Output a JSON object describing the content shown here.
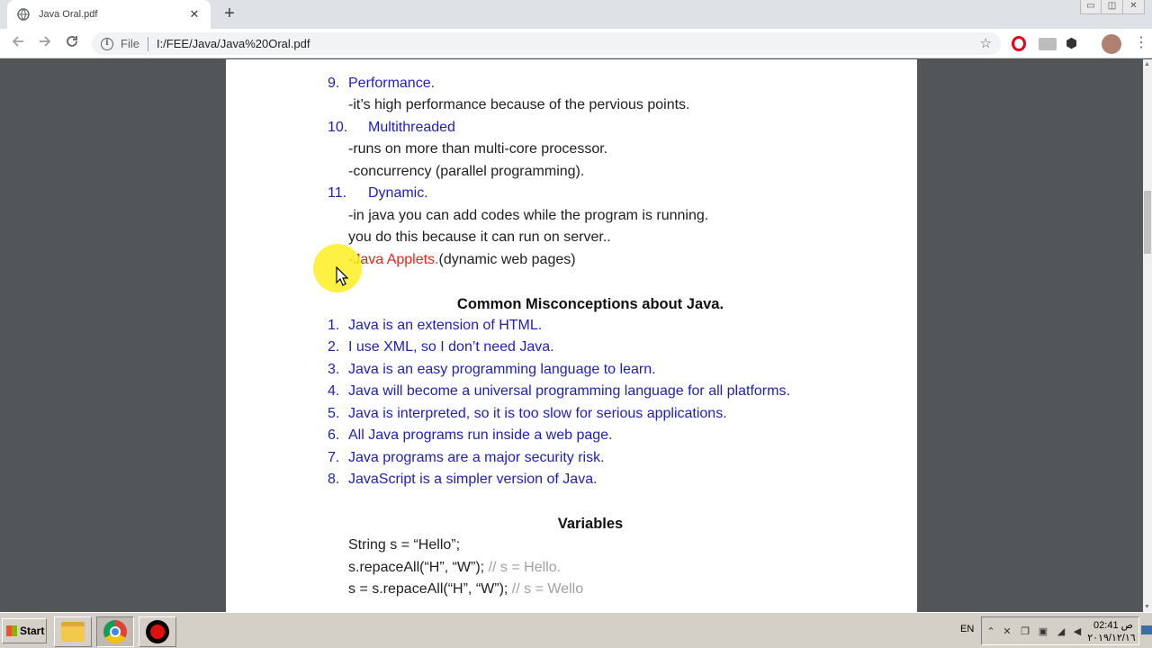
{
  "browser": {
    "tab_title": "Java Oral.pdf",
    "tab_close": "✕",
    "new_tab": "+",
    "omnibox_scheme": "File",
    "url": "I:/FEE/Java/Java%20Oral.pdf",
    "window_controls": [
      "▭",
      "◫",
      "✕"
    ]
  },
  "doc": {
    "item9_num": "9.",
    "item9_title": "Performance.",
    "item9_desc": "-it’s high performance because of the pervious points.",
    "item10_num": "10.",
    "item10_title": "Multithreaded",
    "item10_desc1": "-runs on more than multi-core processor.",
    "item10_desc2": "-concurrency (parallel programming).",
    "item11_num": "11.",
    "item11_title": "Dynamic.",
    "item11_desc1": "-in java you can add codes while the program is running.",
    "item11_desc2": "you do this because it can run on server..",
    "applets_dash": "-",
    "applets_label": "Java Applets.",
    "applets_rest": "(dynamic web pages)",
    "misconceptions_heading": "Common Misconceptions about Java.",
    "misconceptions": [
      {
        "num": "1.",
        "text": "Java is an extension of HTML."
      },
      {
        "num": "2.",
        "text": "I use XML, so I don’t need Java."
      },
      {
        "num": "3.",
        "text": "Java is an easy programming language to learn."
      },
      {
        "num": "4.",
        "text": "Java will become a universal programming language for all platforms."
      },
      {
        "num": "5.",
        "text": "Java is interpreted, so it is too slow for serious applications."
      },
      {
        "num": "6.",
        "text": "All Java programs run inside a web page."
      },
      {
        "num": "7.",
        "text": "Java programs are a major security risk."
      },
      {
        "num": "8.",
        "text": "JavaScript is a simpler version of Java."
      }
    ],
    "variables_heading": "Variables",
    "code1": "String s = “Hello”;",
    "code2": "s.repaceAll(“H”, “W”);",
    "code2_comment": "// s = Hello.",
    "code3": "s = s.repaceAll(“H”, “W”);",
    "code3_comment": "// s = Wello"
  },
  "taskbar": {
    "start_label": "Start",
    "lang": "EN",
    "clock_time": "02:41 ص",
    "clock_date": "٢٠١٩/١٢/١٦"
  },
  "icons": {
    "back": "arrow-left-icon",
    "forward": "arrow-right-icon",
    "reload": "reload-icon",
    "star": "star-icon"
  },
  "colors": {
    "link_blue": "#1f1fb5",
    "applets_red": "#e8261e",
    "comment_gray": "#a0a0a0",
    "viewer_bg": "#525659"
  }
}
